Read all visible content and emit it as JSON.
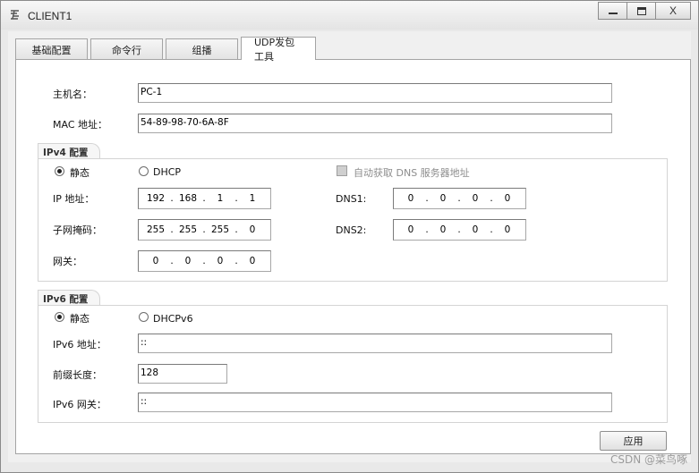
{
  "window": {
    "title": "CLIENT1",
    "minimize": "–",
    "maximize": "□",
    "close": "X"
  },
  "tabs": [
    "基础配置",
    "命令行",
    "组播",
    "UDP发包工具"
  ],
  "basic": {
    "hostname_label": "主机名：",
    "hostname_value": "PC-1",
    "mac_label": "MAC 地址：",
    "mac_value": "54-89-98-70-6A-8F"
  },
  "ipv4": {
    "group_title": "IPv4 配置",
    "static_label": "静态",
    "dhcp_label": "DHCP",
    "auto_dns_label": "自动获取 DNS 服务器地址",
    "ip_label": "IP 地址：",
    "ip": [
      "192",
      "168",
      "1",
      "1"
    ],
    "mask_label": "子网掩码：",
    "mask": [
      "255",
      "255",
      "255",
      "0"
    ],
    "gateway_label": "网关：",
    "gateway": [
      "0",
      "0",
      "0",
      "0"
    ],
    "dns1_label": "DNS1:",
    "dns1": [
      "0",
      "0",
      "0",
      "0"
    ],
    "dns2_label": "DNS2:",
    "dns2": [
      "0",
      "0",
      "0",
      "0"
    ]
  },
  "ipv6": {
    "group_title": "IPv6 配置",
    "static_label": "静态",
    "dhcp_label": "DHCPv6",
    "addr_label": "IPv6 地址：",
    "addr_value": "::",
    "prefix_label": "前缀长度：",
    "prefix_value": "128",
    "gw_label": "IPv6 网关：",
    "gw_value": "::"
  },
  "apply_label": "应用",
  "watermark": "CSDN @菜鸟啄"
}
